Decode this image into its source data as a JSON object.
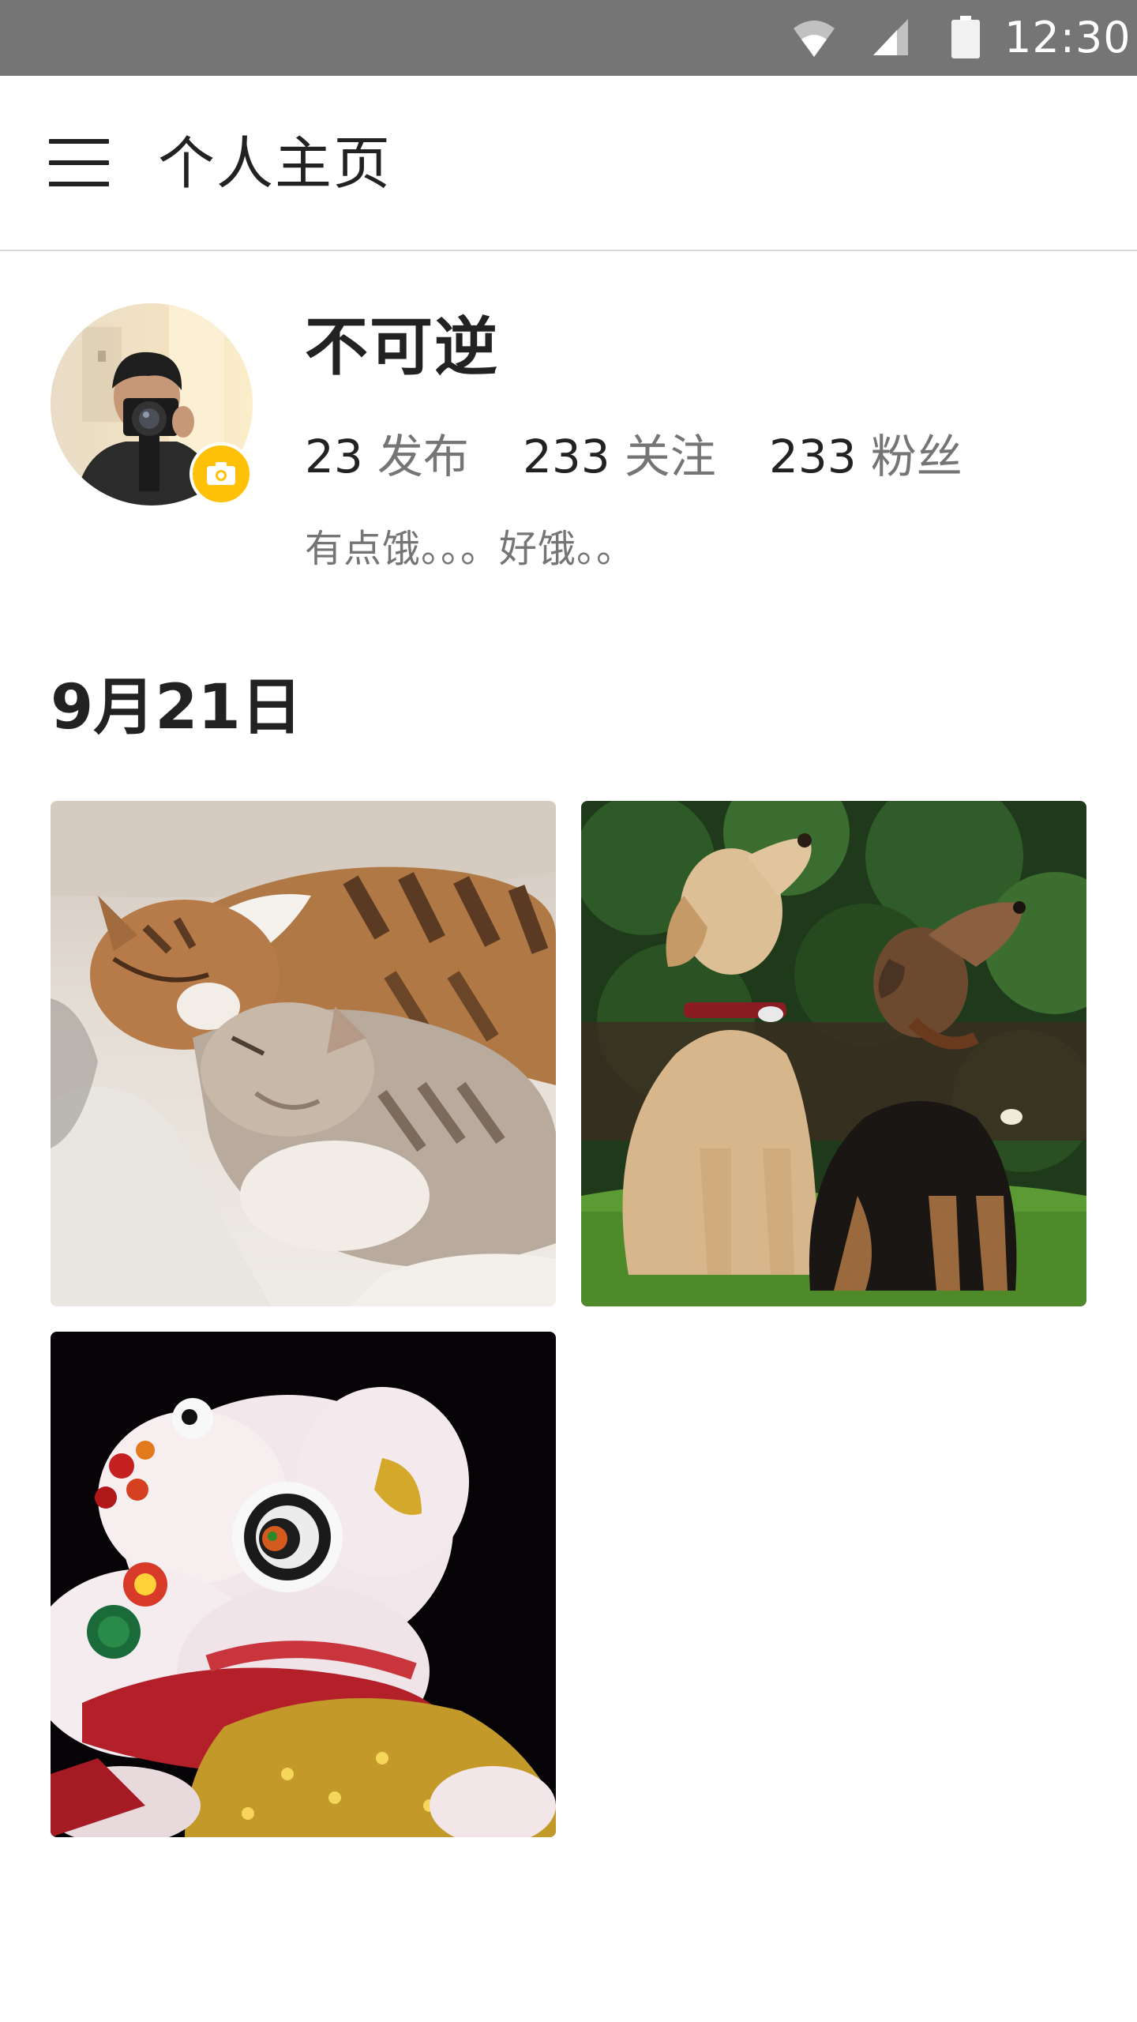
{
  "status_bar": {
    "time": "12:30",
    "icons": [
      "wifi-icon",
      "cell-signal-icon",
      "battery-icon"
    ]
  },
  "app_bar": {
    "menu_icon": "hamburger-menu-icon",
    "title": "个人主页"
  },
  "profile": {
    "avatar_desc": "avatar",
    "camera_badge_icon": "camera-icon",
    "name": "不可逆",
    "stats": [
      {
        "value": "23",
        "label": "发布"
      },
      {
        "value": "233",
        "label": "关注"
      },
      {
        "value": "233",
        "label": "粉丝"
      }
    ],
    "bio": "有点饿。。。好饿。。"
  },
  "feed": {
    "date": "9月21日",
    "photos": [
      {
        "subject": "sleeping-cats-photo"
      },
      {
        "subject": "two-dogs-photo"
      },
      {
        "subject": "lion-dance-photo"
      }
    ]
  },
  "colors": {
    "status_bar_bg": "#757575",
    "accent": "#ffc107",
    "primary_text": "#222222",
    "secondary_text": "#757575",
    "divider": "#d9d9d9"
  }
}
